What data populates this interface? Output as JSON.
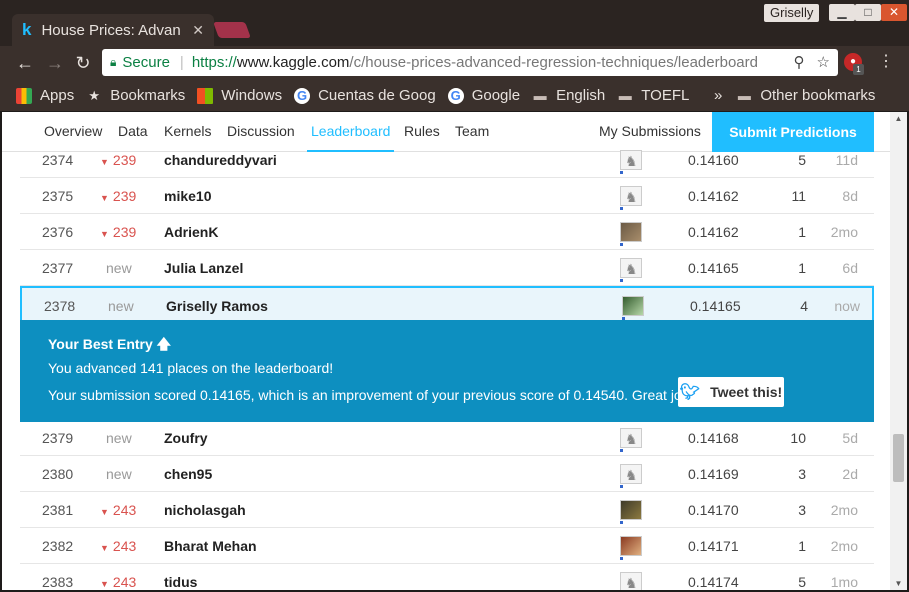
{
  "browser": {
    "tab_title": "House Prices: Advan",
    "profile_name": "Griselly",
    "window_min": "▁",
    "window_max": "□",
    "window_close": "✕",
    "secure_label": "Secure",
    "url_scheme": "https://",
    "url_host": "www.kaggle.com",
    "url_path": "/c/house-prices-advanced-regression-techniques/leaderboard",
    "extension_badge": "1"
  },
  "bookmarks": {
    "items": [
      {
        "label": "Apps",
        "icon": "apps-grid-icon"
      },
      {
        "label": "Bookmarks",
        "icon": "star-icon"
      },
      {
        "label": "Windows",
        "icon": "windows-logo-icon"
      },
      {
        "label": "Cuentas de Goog",
        "icon": "google-icon"
      },
      {
        "label": "Google",
        "icon": "google-icon"
      },
      {
        "label": "English",
        "icon": "folder-icon"
      },
      {
        "label": "TOEFL",
        "icon": "folder-icon"
      }
    ],
    "overflow": "»",
    "other": "Other bookmarks"
  },
  "subnav": {
    "tabs": [
      "Overview",
      "Data",
      "Kernels",
      "Discussion",
      "Leaderboard",
      "Rules",
      "Team"
    ],
    "active": "Leaderboard",
    "my_submissions": "My Submissions",
    "submit": "Submit Predictions"
  },
  "leaderboard": {
    "rows_top": [
      {
        "rank": "2374",
        "change": "239",
        "change_dir": "down",
        "team": "chandureddyvari",
        "score": "0.14160",
        "entries": "5",
        "last": "11d",
        "avatar": "default"
      },
      {
        "rank": "2375",
        "change": "239",
        "change_dir": "down",
        "team": "mike10",
        "score": "0.14162",
        "entries": "11",
        "last": "8d",
        "avatar": "default"
      },
      {
        "rank": "2376",
        "change": "239",
        "change_dir": "down",
        "team": "AdrienK",
        "score": "0.14162",
        "entries": "1",
        "last": "2mo",
        "avatar": "photo"
      },
      {
        "rank": "2377",
        "change": "new",
        "change_dir": "new",
        "team": "Julia Lanzel",
        "score": "0.14165",
        "entries": "1",
        "last": "6d",
        "avatar": "default"
      },
      {
        "rank": "2378",
        "change": "new",
        "change_dir": "new",
        "team": "Griselly Ramos",
        "score": "0.14165",
        "entries": "4",
        "last": "now",
        "avatar": "photo4"
      }
    ],
    "rows_bottom": [
      {
        "rank": "2379",
        "change": "new",
        "change_dir": "new",
        "team": "Zoufry",
        "score": "0.14168",
        "entries": "10",
        "last": "5d",
        "avatar": "default"
      },
      {
        "rank": "2380",
        "change": "new",
        "change_dir": "new",
        "team": "chen95",
        "score": "0.14169",
        "entries": "3",
        "last": "2d",
        "avatar": "default"
      },
      {
        "rank": "2381",
        "change": "243",
        "change_dir": "down",
        "team": "nicholasgah",
        "score": "0.14170",
        "entries": "3",
        "last": "2mo",
        "avatar": "photo2"
      },
      {
        "rank": "2382",
        "change": "243",
        "change_dir": "down",
        "team": "Bharat Mehan",
        "score": "0.14171",
        "entries": "1",
        "last": "2mo",
        "avatar": "photo3"
      },
      {
        "rank": "2383",
        "change": "243",
        "change_dir": "down",
        "team": "tidus",
        "score": "0.14174",
        "entries": "5",
        "last": "1mo",
        "avatar": "default"
      }
    ]
  },
  "best_entry": {
    "title": "Your Best Entry",
    "line1": "You advanced 141 places on the leaderboard!",
    "line2": "Your submission scored 0.14165, which is an improvement of your previous score of 0.14540. Great job!",
    "tweet": "Tweet this!"
  }
}
